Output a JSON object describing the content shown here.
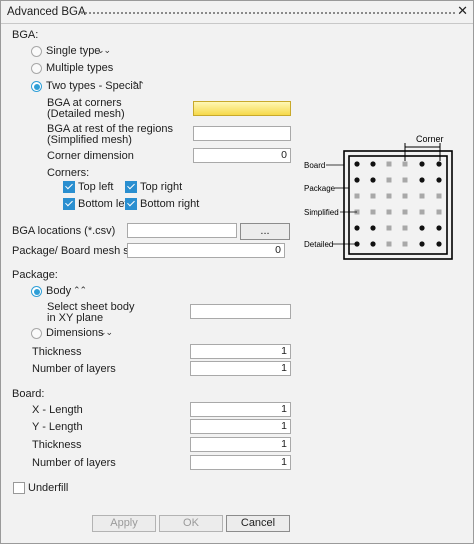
{
  "window": {
    "title": "Advanced BGA",
    "close_glyph": "✕"
  },
  "bga": {
    "section_label": "BGA:",
    "single_type": "Single type",
    "multiple_types": "Multiple types",
    "two_types": "Two types - Special",
    "selected_type": "Two types - Special",
    "corners_l1": "BGA at corners",
    "corners_l2": "(Detailed mesh)",
    "rest_l1": "BGA at rest of the regions",
    "rest_l2": "(Simplified mesh)",
    "corner_dimension_label": "Corner dimension",
    "corner_dimension_value": "0",
    "corners_label": "Corners:",
    "top_left": "Top left",
    "top_right": "Top right",
    "bottom_left": "Bottom left",
    "bottom_right": "Bottom right",
    "locations_label": "BGA locations (*.csv)",
    "browse_label": "...",
    "mesh_size_label": "Package/ Board mesh size",
    "mesh_size_value": "0"
  },
  "diagram": {
    "corner": "Corner",
    "board": "Board",
    "package": "Package",
    "simplified": "Simplified",
    "detailed": "Detailed"
  },
  "package": {
    "section_label": "Package:",
    "body": "Body",
    "select_l1": "Select sheet body",
    "select_l2": "in XY plane",
    "dimensions": "Dimensions",
    "thickness_label": "Thickness",
    "thickness_value": "1",
    "layers_label": "Number of layers",
    "layers_value": "1"
  },
  "board": {
    "section_label": "Board:",
    "x_label": "X - Length",
    "x_value": "1",
    "y_label": "Y - Length",
    "y_value": "1",
    "thickness_label": "Thickness",
    "thickness_value": "1",
    "layers_label": "Number of layers",
    "layers_value": "1"
  },
  "underfill_label": "Underfill",
  "buttons": {
    "apply": "Apply",
    "ok": "OK",
    "cancel": "Cancel"
  },
  "colors": {
    "accent": "#2f9fd7",
    "highlight_field": "#f6d94a",
    "ball_detailed": "#111111",
    "ball_simplified": "#a8a8a8"
  }
}
